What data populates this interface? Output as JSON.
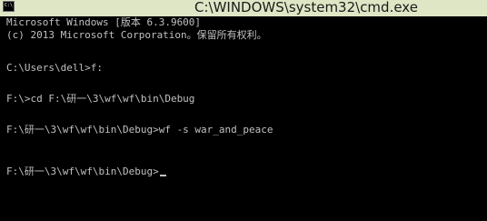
{
  "window": {
    "title": "C:\\WINDOWS\\system32\\cmd.exe",
    "icon_label": "C:\\",
    "icon_name": "cmd-icon"
  },
  "console": {
    "lines": [
      "Microsoft Windows [版本 6.3.9600]",
      "(c) 2013 Microsoft Corporation。保留所有权利。",
      "",
      "C:\\Users\\dell>f:",
      "",
      "F:\\>cd F:\\研一\\3\\wf\\wf\\bin\\Debug",
      "",
      "F:\\研一\\3\\wf\\wf\\bin\\Debug>wf -s war_and_peace",
      "",
      "",
      "F:\\研一\\3\\wf\\wf\\bin\\Debug>"
    ]
  },
  "colors": {
    "console_background": "#000000",
    "console_text": "#c0c0c0",
    "titlebar_background": "#dfe6c6"
  }
}
